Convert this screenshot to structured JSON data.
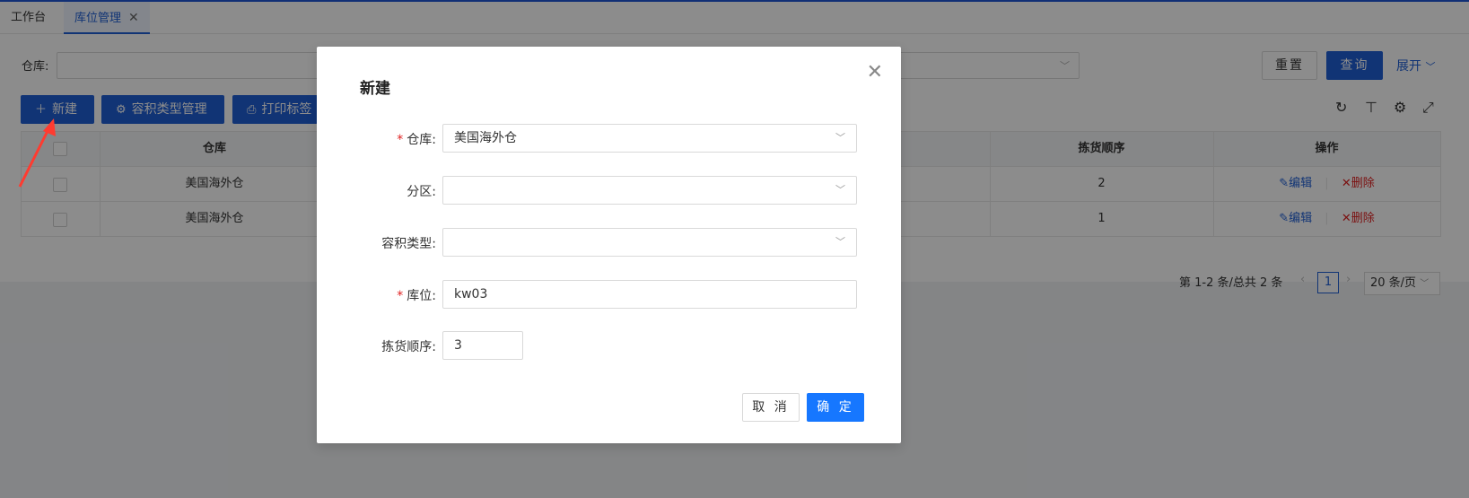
{
  "tabs": [
    {
      "label": "工作台"
    },
    {
      "label": "库位管理",
      "close": "✕"
    }
  ],
  "filter": {
    "warehouse_label": "仓库:",
    "reset_label": "重置",
    "query_label": "查询",
    "expand_label": "展开"
  },
  "toolbar": {
    "new_label": "新建",
    "capacity_label": "容积类型管理",
    "print_label": "打印标签"
  },
  "table": {
    "headers": {
      "warehouse": "仓库",
      "pick_order": "拣货顺序",
      "actions": "操作"
    },
    "rows": [
      {
        "warehouse": "美国海外仓",
        "pick_order": "2",
        "edit": "编辑",
        "delete": "删除"
      },
      {
        "warehouse": "美国海外仓",
        "pick_order": "1",
        "edit": "编辑",
        "delete": "删除"
      }
    ]
  },
  "pager": {
    "summary": "第 1-2 条/总共 2 条",
    "current": "1",
    "page_size": "20 条/页"
  },
  "modal": {
    "title": "新建",
    "fields": {
      "warehouse": {
        "label": "仓库:",
        "value": "美国海外仓",
        "required": "*"
      },
      "zone": {
        "label": "分区:",
        "value": ""
      },
      "capacity_type": {
        "label": "容积类型:",
        "value": ""
      },
      "location": {
        "label": "库位:",
        "value": "kw03",
        "required": "*"
      },
      "pick_order": {
        "label": "拣货顺序:",
        "value": "3"
      }
    },
    "cancel_label": "取 消",
    "ok_label": "确 定"
  },
  "colors": {
    "primary": "#1f5fd6",
    "ok_button": "#1677ff",
    "danger": "#e02020",
    "annotation_arrow": "#ff3b30"
  }
}
